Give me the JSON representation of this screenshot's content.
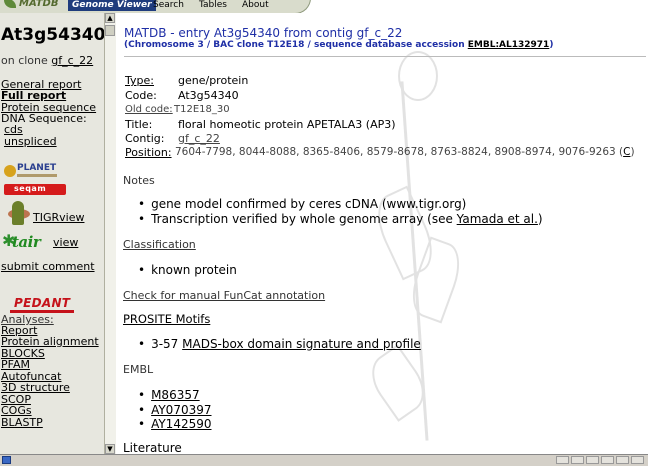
{
  "nav": {
    "logo": "MATDB",
    "items": [
      "Genome Viewer",
      "Search",
      "Tables",
      "About"
    ]
  },
  "sidebar": {
    "gene_id": "At3g54340",
    "on_clone_prefix": "on clone",
    "clone": "gf_c_22",
    "links": {
      "general_report": "General  report",
      "full_report": "Full report",
      "protein_sequence": "Protein sequence",
      "dna_sequence_label": "DNA Sequence:",
      "cds": "cds",
      "unspliced": "unspliced",
      "tigrview": "TIGRview",
      "tair_view": "view",
      "submit_comment": "submit comment",
      "analyses": "Analyses:",
      "report": "Report",
      "protein_alignment": "Protein alignment",
      "blocks": "BLOCKS",
      "pfam": "PFAM",
      "autofuncat": "Autofuncat",
      "structure_3d": "3D structure",
      "scop": "SCOP",
      "cogs": "COGs",
      "blastp": "BLASTP"
    },
    "logos": {
      "planet": "PLANET",
      "seqam": "seqam",
      "tair": "tair",
      "pedant": "PEDANT"
    }
  },
  "main": {
    "title": "MATDB - entry At3g54340 from contig gf_c_22",
    "subtitle_prefix": "(Chromosome 3 / BAC clone T12E18 / sequence database accession ",
    "subtitle_accession": "EMBL:AL132971",
    "subtitle_suffix": ")",
    "fields": {
      "type_label": "Type:",
      "type_value": "gene/protein",
      "code_label": "Code:",
      "code_value": "At3g54340",
      "oldcode_label": "Old code:",
      "oldcode_value": "T12E18_30",
      "title_label": "Title:",
      "title_value": "floral homeotic protein APETALA3 (AP3)",
      "contig_label": "Contig:",
      "contig_value": "gf_c_22",
      "position_label": "Position:",
      "position_value": "7604-7798, 8044-8088, 8365-8406, 8579-8678, 8763-8824, 8908-8974, 9076-9263 (",
      "position_strand": "C",
      "position_close": ")"
    },
    "notes_heading": "Notes",
    "notes": [
      "gene model confirmed by ceres cDNA (www.tigr.org)",
      "Transcription verified by whole genome array (see ",
      "Yamada et al.",
      ")"
    ],
    "classification_heading": "Classification",
    "classification_item": "known protein",
    "funcat_link": "Check for manual FunCat annotation",
    "prosite_heading": "PROSITE Motifs",
    "prosite_range": "3-57",
    "prosite_item": "MADS-box domain signature and profile",
    "embl_heading": "EMBL",
    "embl_items": [
      "M86357",
      "AY070397",
      "AY142590"
    ],
    "literature_heading": "Literature"
  }
}
